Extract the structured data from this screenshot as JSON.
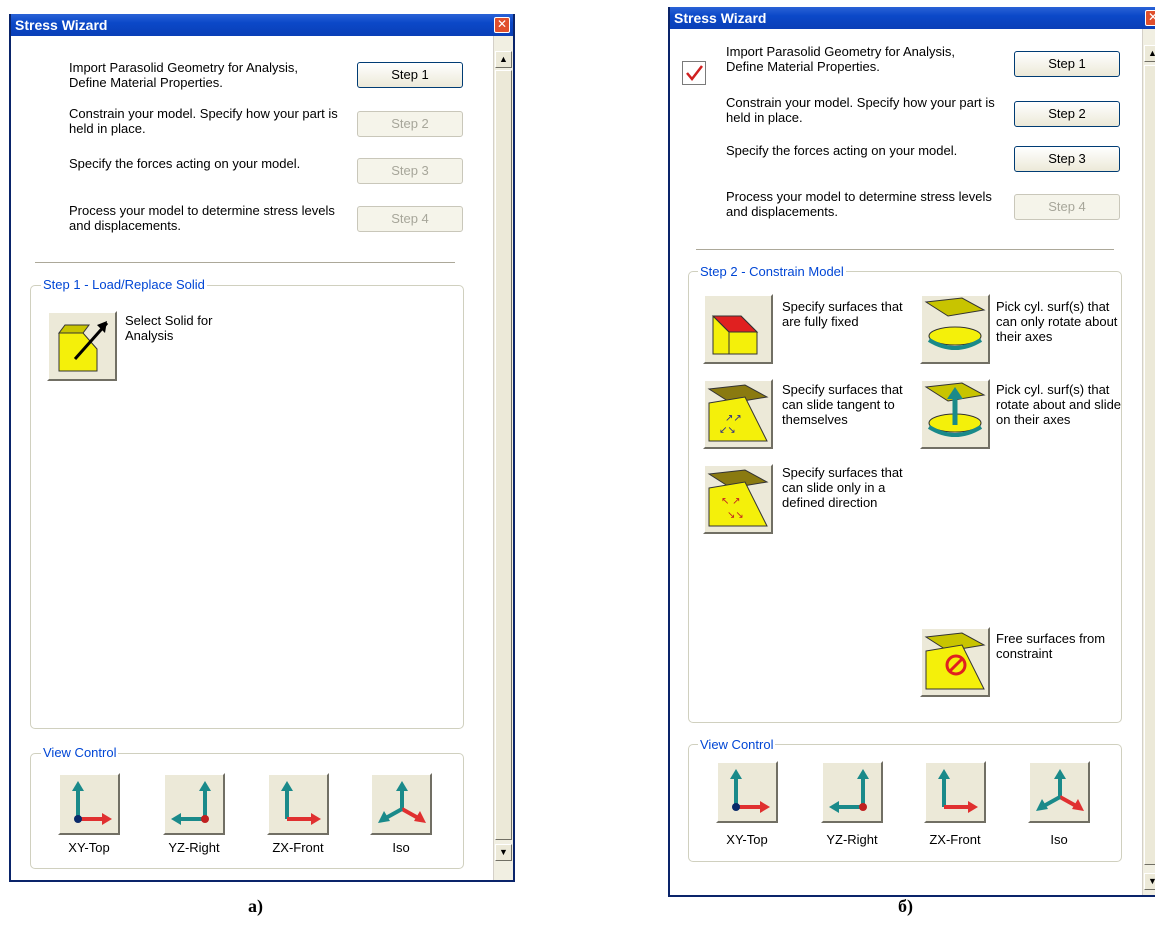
{
  "window_a": {
    "title": "Stress Wizard",
    "steps": [
      {
        "description": "Import Parasolid Geometry for Analysis, Define Material Properties.",
        "button": "Step 1",
        "enabled": true
      },
      {
        "description": "Constrain your model. Specify how your part is held in place.",
        "button": "Step 2",
        "enabled": false
      },
      {
        "description": "Specify the forces acting on your model.",
        "button": "Step 3",
        "enabled": false
      },
      {
        "description": "Process your model to determine stress levels and displacements.",
        "button": "Step 4",
        "enabled": false
      }
    ],
    "step_group": {
      "title": "Step 1 - Load/Replace Solid",
      "action_label": "Select Solid for Analysis"
    },
    "view_control": {
      "title": "View Control",
      "buttons": [
        "XY-Top",
        "YZ-Right",
        "ZX-Front",
        "Iso"
      ]
    },
    "caption": "а)"
  },
  "window_b": {
    "title": "Stress Wizard",
    "step1_completed": true,
    "steps": [
      {
        "description": "Import Parasolid Geometry for Analysis, Define Material Properties.",
        "button": "Step 1",
        "enabled": true
      },
      {
        "description": "Constrain your model. Specify how your part is held in place.",
        "button": "Step 2",
        "enabled": true
      },
      {
        "description": "Specify the forces acting on your model.",
        "button": "Step 3",
        "enabled": true
      },
      {
        "description": "Process your model to determine stress levels and displacements.",
        "button": "Step 4",
        "enabled": false
      }
    ],
    "step_group": {
      "title": "Step 2 - Constrain Model",
      "actions": [
        {
          "label": "Specify surfaces that are fully fixed",
          "icon": "fixed-surface-icon"
        },
        {
          "label": "Pick cyl. surf(s) that can only rotate about their axes",
          "icon": "cylinder-rotate-icon"
        },
        {
          "label": "Specify surfaces that can slide tangent to themselves",
          "icon": "slide-tangent-icon"
        },
        {
          "label": "Pick cyl. surf(s) that rotate about and slide on their axes",
          "icon": "cylinder-rotate-slide-icon"
        },
        {
          "label": "Specify surfaces that can slide only in a defined direction",
          "icon": "slide-direction-icon"
        },
        {
          "label": "Free surfaces from constraint",
          "icon": "free-surface-icon"
        }
      ]
    },
    "view_control": {
      "title": "View Control",
      "buttons": [
        "XY-Top",
        "YZ-Right",
        "ZX-Front",
        "Iso"
      ]
    },
    "caption": "б)"
  },
  "colors": {
    "titlebar": "#0b48c8",
    "legend_text": "#0046d5",
    "axis_red": "#e03030",
    "axis_teal": "#1a8a8a",
    "solid_yellow": "#f4f00a"
  }
}
